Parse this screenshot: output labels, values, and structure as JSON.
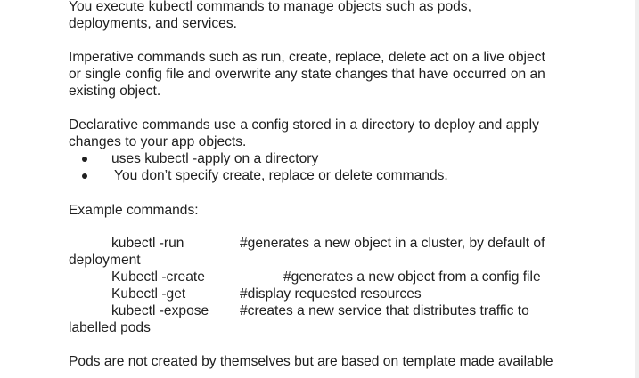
{
  "document": {
    "intro": {
      "line1": "You execute kubectl commands to manage objects such as pods,",
      "line2": "deployments, and services."
    },
    "imperative": {
      "line1": "Imperative commands such as run, create, replace, delete act on a live object",
      "line2": "or single config file and overwrite any state changes that have occurred on an",
      "line3": "existing object."
    },
    "declarative": {
      "line1": "Declarative commands use a config stored in a directory to deploy and apply",
      "line2": "changes to your app objects.",
      "bullets": [
        "uses kubectl -apply on a directory",
        "You don’t specify create, replace or delete commands."
      ]
    },
    "examples": {
      "heading": "Example commands:",
      "commands": [
        {
          "cmd": "kubectl -run",
          "comment": "#generates a new object in a cluster, by default of",
          "wrap": "deployment"
        },
        {
          "cmd": "Kubectl -create",
          "comment": "#generates a new object from a config file"
        },
        {
          "cmd": "Kubectl -get",
          "comment": "#display requested resources"
        },
        {
          "cmd": "kubectl -expose",
          "comment": "#creates a new service that distributes traffic to",
          "wrap": "labelled pods"
        }
      ]
    },
    "pods": {
      "line1": "Pods are not created by themselves but are based on template made available"
    }
  }
}
